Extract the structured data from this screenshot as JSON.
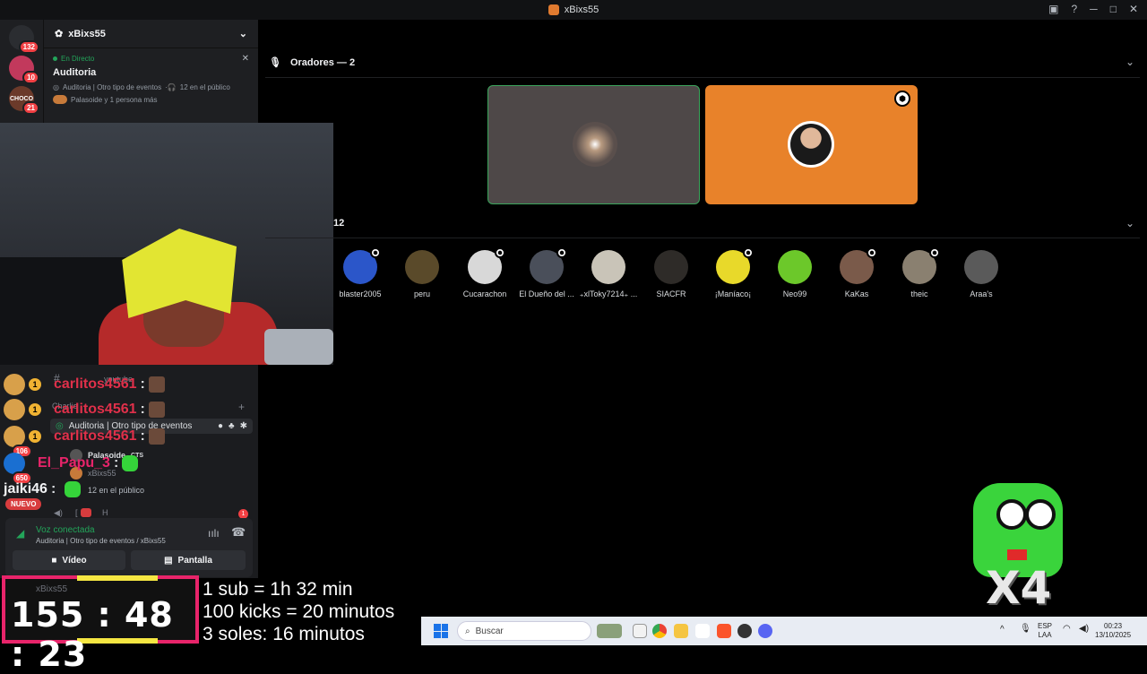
{
  "window": {
    "title": "xBixs55"
  },
  "servers": [
    {
      "badge": "132",
      "color": "#202225"
    },
    {
      "badge": "10",
      "color": "#c2395c"
    },
    {
      "badge": "21",
      "color": "#6b3a2a",
      "label": "CHOCO"
    }
  ],
  "channel_panel": {
    "server_name": "xBixs55",
    "live_label": "En Directo",
    "event_title": "Auditoria",
    "event_meta": "Auditoria | Otro tipo de eventos",
    "audience_count": "12 en el público",
    "attendees_text": "Palasoide y 1 persona más"
  },
  "chat": {
    "lines": [
      {
        "user": "carlitos4561",
        "color": "#e0304a",
        "badge": "1"
      },
      {
        "user": "carlitos4561",
        "color": "#e0304a",
        "badge": "1"
      },
      {
        "user": "carlitos4561",
        "color": "#e0304a",
        "badge": "1"
      },
      {
        "user": "El_Papu_3",
        "color": "#e8246a"
      },
      {
        "user": "jaiki46",
        "color": "#f2f3f5"
      }
    ],
    "rail_badges": [
      "106",
      "650"
    ],
    "nuevo_label": "NUEVO"
  },
  "sidebar_lower": {
    "ghost_channel": "youtube",
    "ghost_user": "Charlie",
    "voice_channel_label": "Auditoria | Otro tipo de eventos",
    "member_name": "Palasoide",
    "member_tag": "CTS",
    "member2": "xBixs55",
    "audience_text": "12 en el público",
    "ghost_h": "H",
    "ghost_h_badge": "1"
  },
  "voice": {
    "status": "Voz conectada",
    "subtitle": "Auditoria | Otro tipo de eventos / xBixs55",
    "video_label": "Vídeo",
    "screen_label": "Pantalla"
  },
  "timer": {
    "value": "155 : 48 : 23",
    "ghost_name": "xBixs55"
  },
  "rates": [
    "1 sub = 1h 32 min",
    "100 kicks = 20 minutos",
    "3 soles: 16 minutos"
  ],
  "stage": {
    "speakers_header": "Oradores — 2",
    "audience_header": "12",
    "speaker_tiles": [
      {
        "bg": "#4e4848",
        "border": "#3ba55c"
      },
      {
        "bg": "#e8822a",
        "border": "#e8822a"
      }
    ],
    "audience": [
      {
        "name": "blaster2005",
        "color": "#2b56c9"
      },
      {
        "name": "peru",
        "color": "#5a4a2a"
      },
      {
        "name": "Cucarachon",
        "color": "#d8d8d8"
      },
      {
        "name": "El Dueño del ...",
        "color": "#4a4f5a"
      },
      {
        "name": "₊xlToky7214₊ ...",
        "color": "#c9c4b8"
      },
      {
        "name": "SIACFR",
        "color": "#2e2b28"
      },
      {
        "name": "¡Maníaco¡",
        "color": "#e8d92a"
      },
      {
        "name": "Neo99",
        "color": "#6cc82a"
      },
      {
        "name": "KaKas",
        "color": "#7a5a4a"
      },
      {
        "name": "theic",
        "color": "#8a8070"
      },
      {
        "name": "Araa's",
        "color": "#5a5a5a"
      }
    ]
  },
  "mascot": {
    "label": "X4"
  },
  "taskbar": {
    "search_placeholder": "Buscar",
    "lang_top": "ESP",
    "lang_bottom": "LAA",
    "time": "00:23",
    "date": "13/10/2025"
  }
}
